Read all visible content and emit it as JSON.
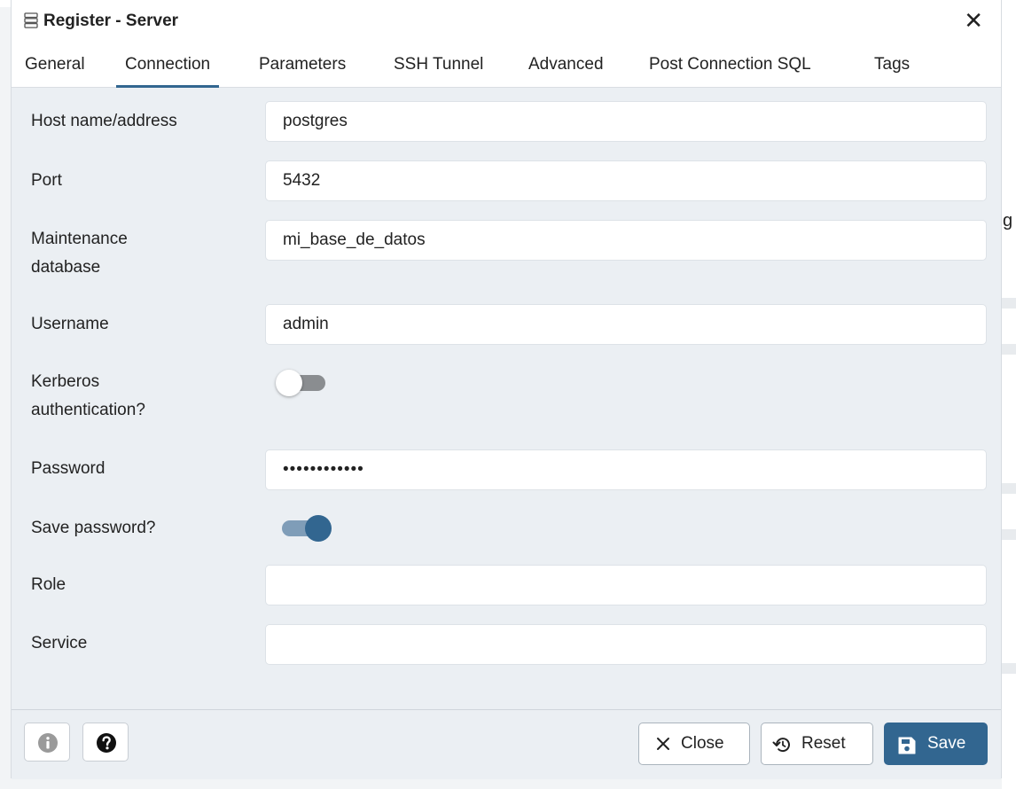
{
  "dialog": {
    "title": "Register - Server",
    "close_glyph": "✕"
  },
  "tabs": [
    {
      "label": "General"
    },
    {
      "label": "Connection",
      "active": true
    },
    {
      "label": "Parameters"
    },
    {
      "label": "SSH Tunnel"
    },
    {
      "label": "Advanced"
    },
    {
      "label": "Post Connection SQL"
    },
    {
      "label": "Tags"
    }
  ],
  "form": {
    "host_label": "Host name/address",
    "host_value": "postgres",
    "port_label": "Port",
    "port_value": "5432",
    "maint_label_line1": "Maintenance",
    "maint_label_line2": "database",
    "maint_value": "mi_base_de_datos",
    "username_label": "Username",
    "username_value": "admin",
    "kerberos_label_line1": "Kerberos",
    "kerberos_label_line2": "authentication?",
    "kerberos_enabled": false,
    "password_label": "Password",
    "password_value": "••••••••••••",
    "save_password_label": "Save password?",
    "save_password_enabled": true,
    "role_label": "Role",
    "role_value": "",
    "service_label": "Service",
    "service_value": ""
  },
  "footer": {
    "info_icon": "info-circle-icon",
    "help_icon": "question-icon",
    "close_label": "Close",
    "reset_label": "Reset",
    "save_label": "Save"
  },
  "background": {
    "partial_glyph": "g"
  },
  "colors": {
    "accent": "#326690",
    "dialog_bg": "#ebeff3"
  }
}
